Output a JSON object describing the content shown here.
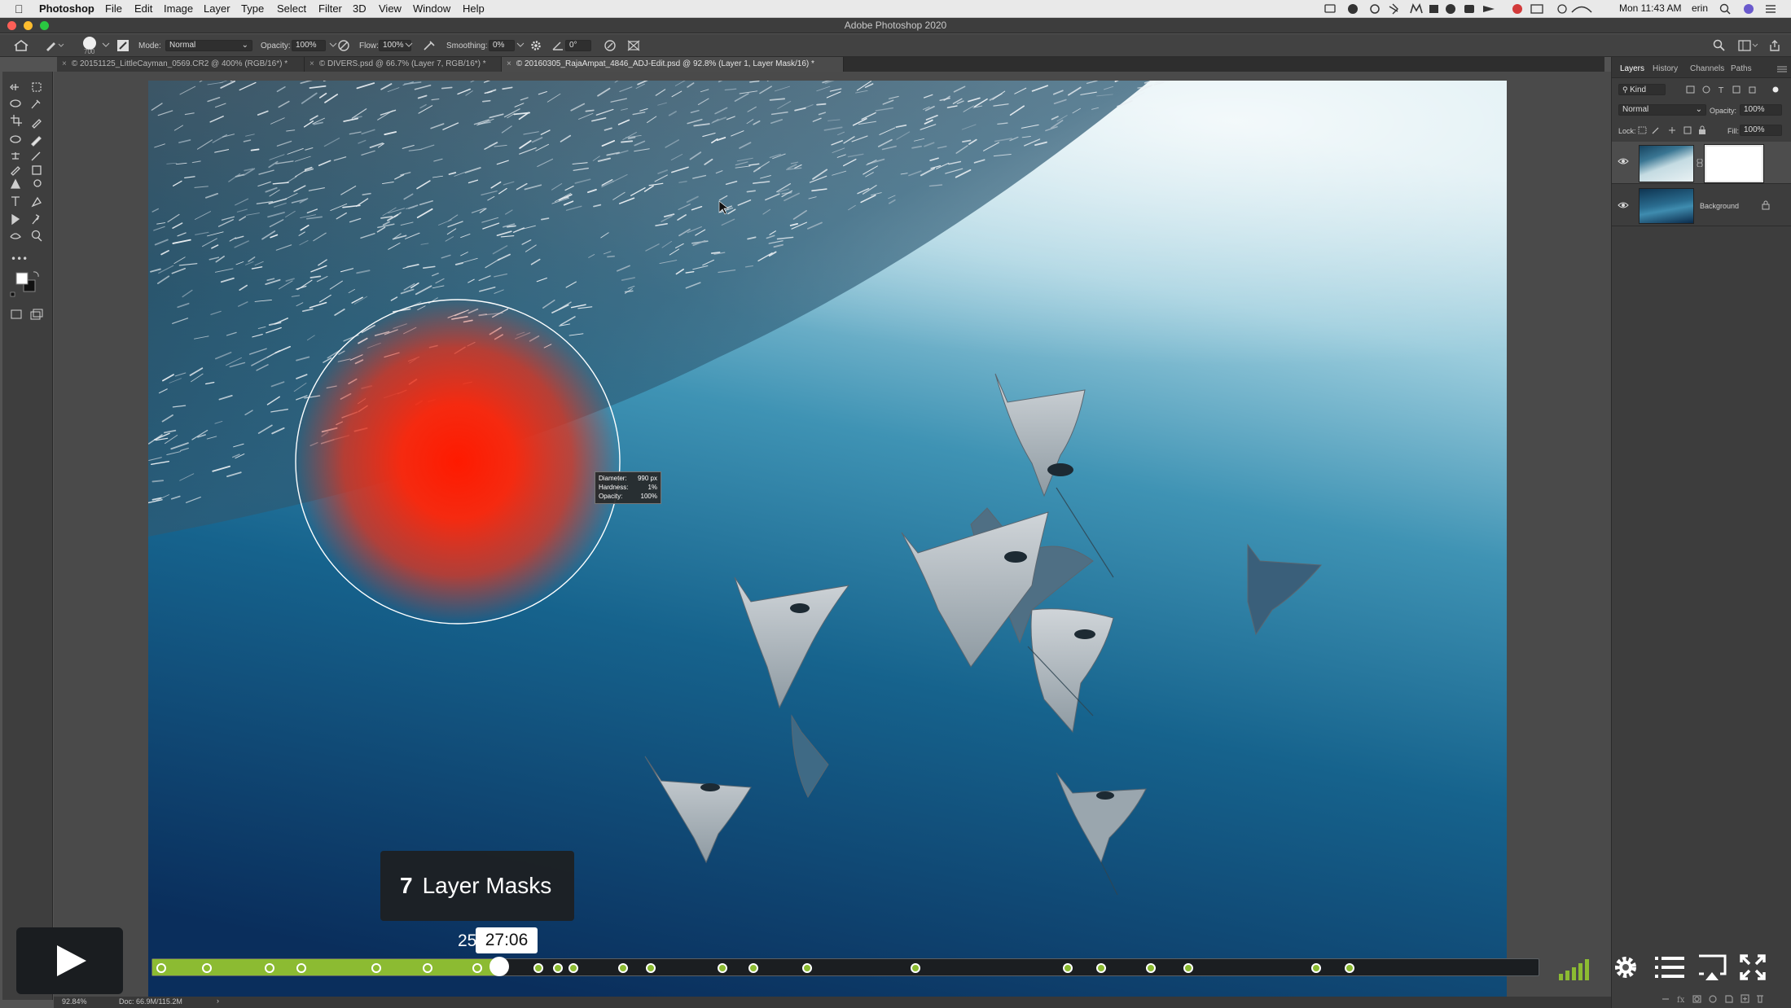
{
  "menubar": {
    "app_name": "Photoshop",
    "items": [
      "File",
      "Edit",
      "Image",
      "Layer",
      "Type",
      "Select",
      "Filter",
      "3D",
      "View",
      "Window",
      "Help"
    ],
    "clock": "Mon 11:43 AM",
    "user": "erin"
  },
  "window": {
    "title": "Adobe Photoshop 2020"
  },
  "options": {
    "brush_size": "700",
    "mode_label": "Mode:",
    "mode_value": "Normal",
    "opacity_label": "Opacity:",
    "opacity_value": "100%",
    "flow_label": "Flow:",
    "flow_value": "100%",
    "smoothing_label": "Smoothing:",
    "smoothing_value": "0%",
    "angle_value": "0°"
  },
  "doc_tabs": [
    {
      "label": "© 20151125_LittleCayman_0569.CR2 @ 400% (RGB/16*) *",
      "active": false
    },
    {
      "label": "© DIVERS.psd @ 66.7% (Layer 7, RGB/16*) *",
      "active": false
    },
    {
      "label": "© 20160305_RajaAmpat_4846_ADJ-Edit.psd @ 92.8% (Layer 1, Layer Mask/16) *",
      "active": true
    }
  ],
  "brush_tooltip": {
    "diameter_label": "Diameter:",
    "diameter_value": "990 px",
    "hardness_label": "Hardness:",
    "hardness_value": "1%",
    "opacity_label": "Opacity:",
    "opacity_value": "100%"
  },
  "panel": {
    "tabs": [
      "Layers",
      "History",
      "Channels",
      "Paths"
    ],
    "filter_kind": "Kind",
    "blend_mode": "Normal",
    "opacity_label": "Opacity:",
    "opacity_value": "100%",
    "lock_label": "Lock:",
    "fill_label": "Fill:",
    "fill_value": "100%",
    "layers": [
      {
        "name": "",
        "has_mask": true,
        "visible": true
      },
      {
        "name": "Background",
        "has_mask": false,
        "visible": true,
        "locked": true
      }
    ]
  },
  "status": {
    "zoom": "92.84%",
    "doc": "Doc: 66.9M/115.2M"
  },
  "video": {
    "chapter_number": "7",
    "chapter_title": "Layer Masks",
    "hover_time": "25",
    "current_time": "27:06",
    "progress": 0.25,
    "chapter_marks": [
      0.003,
      0.036,
      0.081,
      0.104,
      0.158,
      0.195,
      0.231,
      0.275,
      0.289,
      0.3,
      0.336,
      0.356,
      0.408,
      0.43,
      0.469,
      0.547,
      0.657,
      0.681,
      0.717,
      0.744,
      0.836,
      0.86
    ],
    "accent_color": "#8cbb32"
  }
}
